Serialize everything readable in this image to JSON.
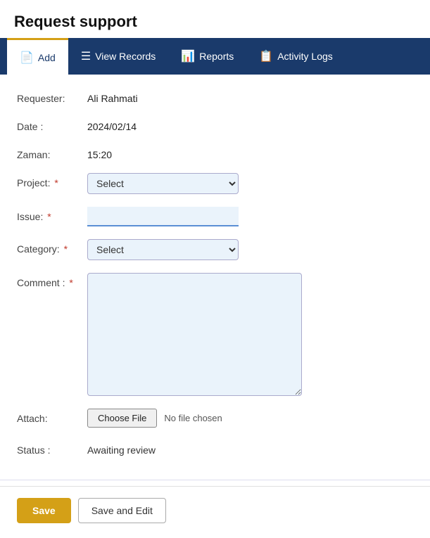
{
  "page": {
    "title": "Request support"
  },
  "nav": {
    "items": [
      {
        "id": "add",
        "label": "Add",
        "icon": "📄",
        "active": true
      },
      {
        "id": "view-records",
        "label": "View Records",
        "icon": "☰",
        "active": false
      },
      {
        "id": "reports",
        "label": "Reports",
        "icon": "📊",
        "active": false
      },
      {
        "id": "activity-logs",
        "label": "Activity Logs",
        "icon": "📋",
        "active": false
      }
    ]
  },
  "form": {
    "requester_label": "Requester:",
    "requester_value": "Ali Rahmati",
    "date_label": "Date :",
    "date_value": "2024/02/14",
    "zaman_label": "Zaman:",
    "zaman_value": "15:20",
    "project_label": "Project:",
    "project_placeholder": "Select",
    "issue_label": "Issue:",
    "category_label": "Category:",
    "category_placeholder": "Select",
    "comment_label": "Comment :",
    "attach_label": "Attach:",
    "choose_file_label": "Choose File",
    "no_file_label": "No file chosen",
    "status_label": "Status :",
    "status_value": "Awaiting review"
  },
  "footer": {
    "save_label": "Save",
    "save_edit_label": "Save and Edit"
  }
}
